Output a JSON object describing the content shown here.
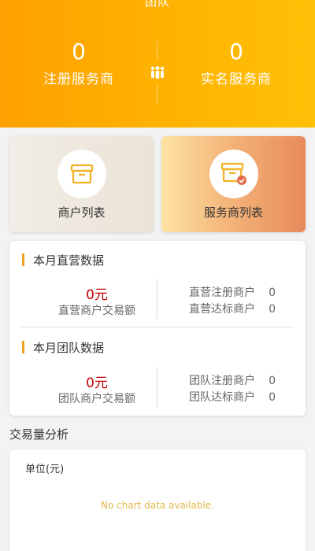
{
  "header": {
    "title": "团队",
    "registered": {
      "value": "0",
      "label": "注册服务商"
    },
    "verified": {
      "value": "0",
      "label": "实名服务商"
    },
    "team_icon": "team-people-icon"
  },
  "cards": {
    "merchant": {
      "label": "商户列表",
      "icon": "box-icon"
    },
    "provider": {
      "label": "服务商列表",
      "icon": "box-check-icon"
    }
  },
  "monthly_direct": {
    "title": "本月直营数据",
    "amount": "0元",
    "amount_label": "直营商户交易额",
    "items": [
      {
        "label": "直营注册商户",
        "value": "0"
      },
      {
        "label": "直营达标商户",
        "value": "0"
      }
    ]
  },
  "monthly_team": {
    "title": "本月团队数据",
    "amount": "0元",
    "amount_label": "团队商户交易额",
    "items": [
      {
        "label": "团队注册商户",
        "value": "0"
      },
      {
        "label": "团队达标商户",
        "value": "0"
      }
    ]
  },
  "analysis": {
    "title": "交易量分析",
    "unit": "单位(元)",
    "empty_text": "No chart data available."
  },
  "colors": {
    "header_orange": "#ffb300",
    "accent": "#f0a020",
    "amount_red": "#c40000"
  }
}
